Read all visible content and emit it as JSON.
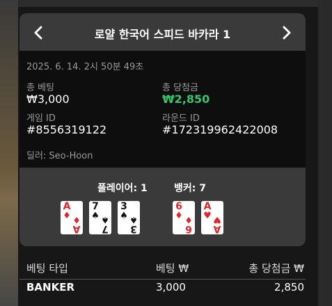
{
  "header": {
    "title": "로얄 한국어 스피드 바카라 1"
  },
  "info": {
    "timestamp": "2025. 6. 14. 2시 50분 49초",
    "total_bet_label": "총 베팅",
    "total_bet_value": "₩3,000",
    "total_win_label": "총 당첨금",
    "total_win_value": "₩2,850",
    "game_id_label": "게임 ID",
    "game_id_value": "#8556319122",
    "round_id_label": "라운드 ID",
    "round_id_value": "#172319962422008",
    "dealer": "딜러: Seo-Hoon"
  },
  "hands": {
    "player_label": "플레이어: 1",
    "banker_label": "뱅커: 7",
    "player_cards": [
      {
        "rank": "A",
        "suit": "♦",
        "color": "#e0262b"
      },
      {
        "rank": "7",
        "suit": "♠",
        "color": "#111111"
      },
      {
        "rank": "3",
        "suit": "♠",
        "color": "#111111"
      }
    ],
    "banker_cards": [
      {
        "rank": "6",
        "suit": "♦",
        "color": "#e0262b"
      },
      {
        "rank": "A",
        "suit": "♥",
        "color": "#e0262b"
      }
    ]
  },
  "table": {
    "headers": [
      "베팅 타입",
      "베팅 ₩",
      "총 당첨금 ₩"
    ],
    "rows": [
      {
        "type": "BANKER",
        "bet": "3,000",
        "win": "2,850"
      }
    ]
  },
  "colors": {
    "win_green": "#31c76a",
    "card_red": "#e0262b",
    "panel_bg": "#3a3a3a"
  },
  "icons": {
    "prev": "chevron-left-icon",
    "next": "chevron-right-icon"
  }
}
